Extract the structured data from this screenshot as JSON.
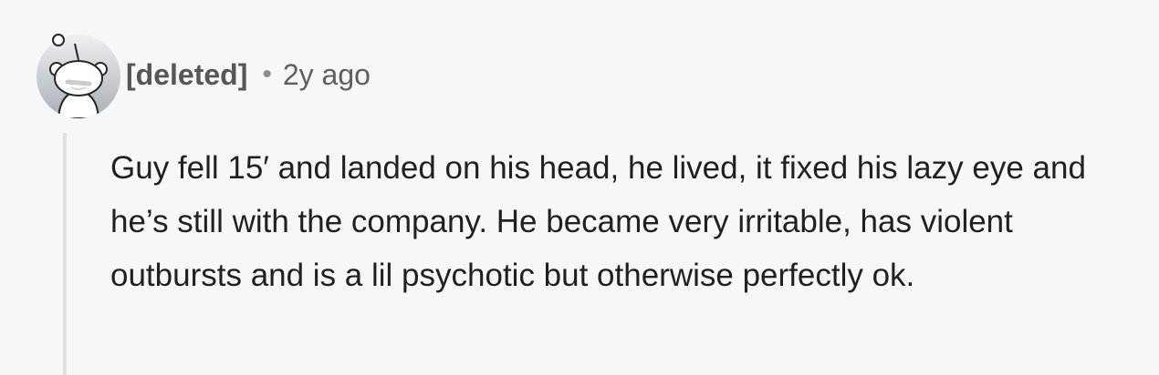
{
  "comment": {
    "avatar_icon": "snoo-avatar-icon",
    "author": "[deleted]",
    "separator": "•",
    "timestamp": "2y ago",
    "body": "Guy fell 15′ and landed on his head, he lived, it fixed his lazy eye and he’s still with the company. He became very irritable, has violent outbursts and is a lil psychotic but otherwise perfectly ok."
  },
  "colors": {
    "background": "#f6f7f8",
    "author": "#545659",
    "body_text": "#1f2022",
    "thread_line": "#dfe1e3"
  }
}
